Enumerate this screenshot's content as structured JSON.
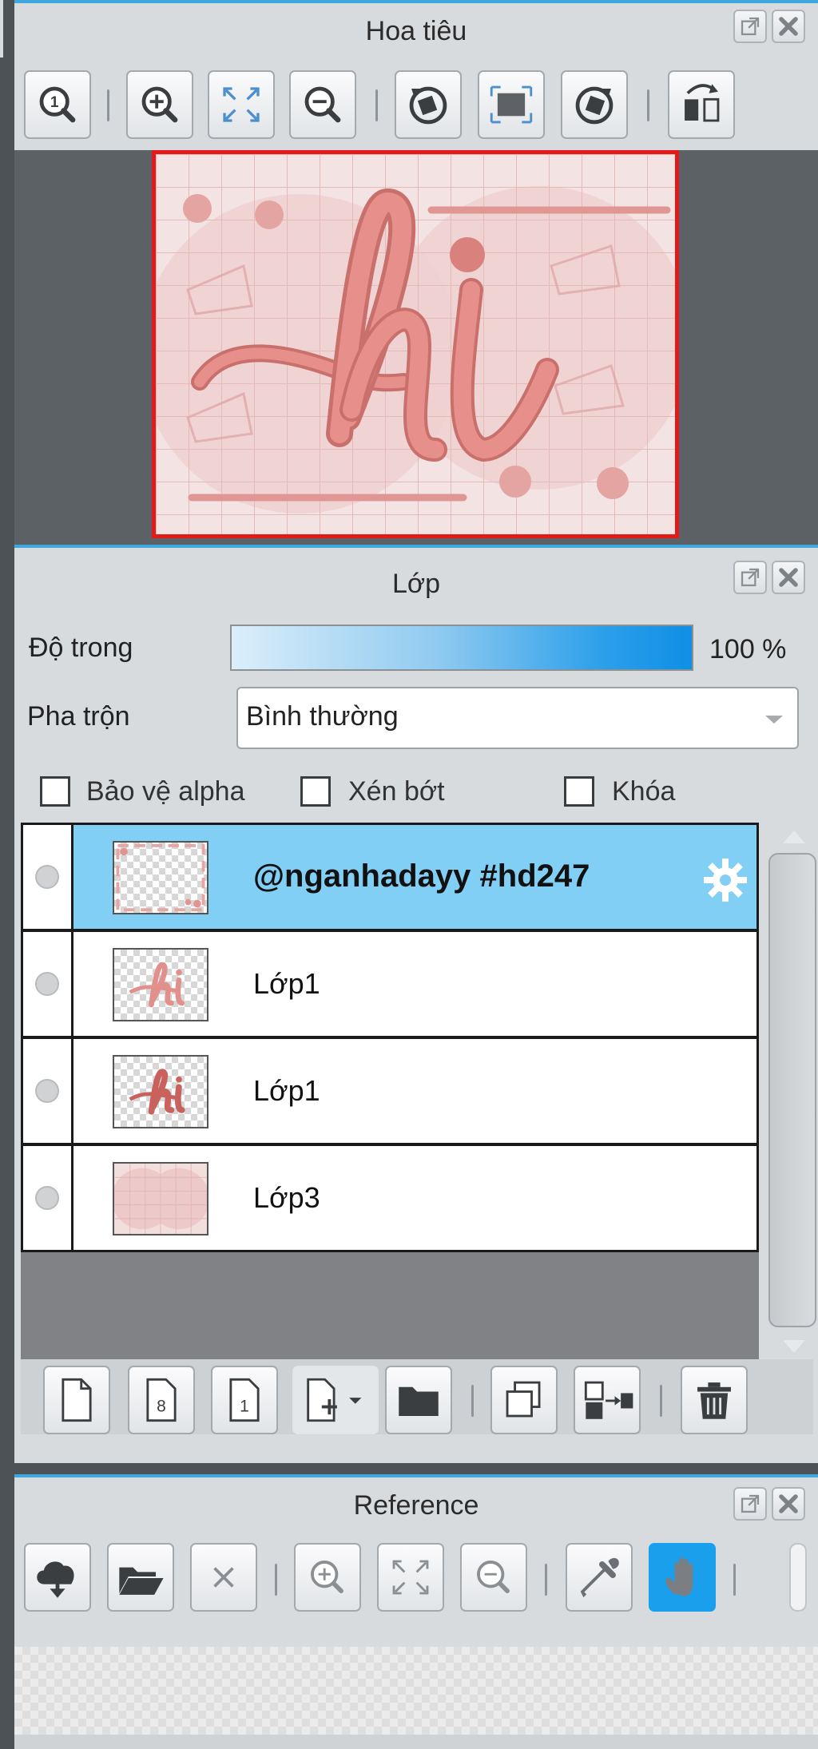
{
  "navigator": {
    "title": "Hoa tiêu",
    "toolbar": [
      "actual-size",
      "zoom-in",
      "fit-screen",
      "zoom-out",
      "rotate-left",
      "reset-rotation",
      "rotate-right",
      "flip-horizontal"
    ],
    "preview_text": "hi"
  },
  "layers": {
    "title": "Lớp",
    "opacity_label": "Độ trong",
    "opacity_value": "100 %",
    "opacity_fraction": 1.0,
    "blend_label": "Pha trộn",
    "blend_value": "Bình thường",
    "checkboxes": [
      {
        "label": "Bảo vệ alpha",
        "checked": false
      },
      {
        "label": "Xén bớt",
        "checked": false
      },
      {
        "label": "Khóa",
        "checked": false
      }
    ],
    "items": [
      {
        "name": "@nganhadayy #hd247",
        "selected": true
      },
      {
        "name": "Lớp1",
        "selected": false
      },
      {
        "name": "Lớp1",
        "selected": false
      },
      {
        "name": "Lớp3",
        "selected": false
      }
    ],
    "toolbar": [
      "new-layer",
      "new-8bit-layer",
      "new-1bit-layer",
      "add-layer-menu",
      "new-folder",
      "duplicate-layer",
      "merge-down",
      "delete-layer"
    ]
  },
  "reference": {
    "title": "Reference",
    "toolbar": [
      "load-from-cloud",
      "open-file",
      "close",
      "zoom-in",
      "fit-screen",
      "zoom-out",
      "eyedropper",
      "hand-tool"
    ],
    "active_tool": "hand-tool"
  },
  "colors": {
    "accent": "#3fa7e0",
    "selected_row": "#82cff6",
    "frame": "#e21a1a",
    "art_pink": "#e08c88"
  }
}
